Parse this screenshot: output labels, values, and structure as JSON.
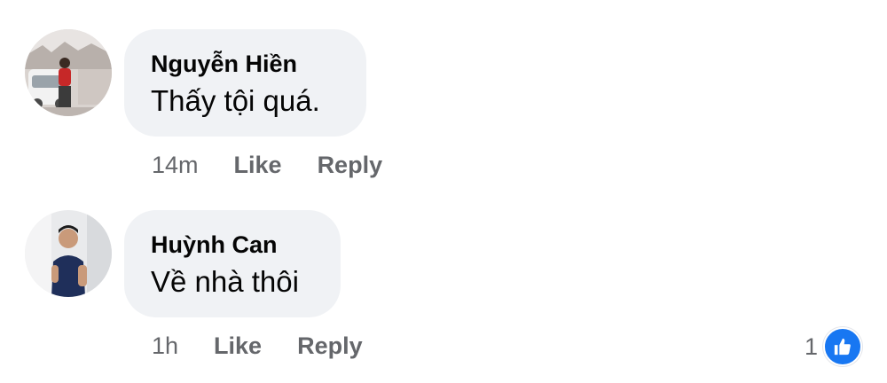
{
  "colors": {
    "bubble_background": "#f0f2f5",
    "primary_text": "#050505",
    "secondary_text": "#65676b",
    "reaction_blue": "#1877f2"
  },
  "comments": [
    {
      "author": "Nguyễn Hiền",
      "text": "Thấy tội quá.",
      "time": "14m",
      "like_label": "Like",
      "reply_label": "Reply",
      "avatar_icon": "user-photo"
    },
    {
      "author": "Huỳnh Can",
      "text": "Về nhà thôi",
      "time": "1h",
      "like_label": "Like",
      "reply_label": "Reply",
      "avatar_icon": "user-photo",
      "reaction_count": "1",
      "reaction_icon": "thumbs-up-icon"
    }
  ]
}
